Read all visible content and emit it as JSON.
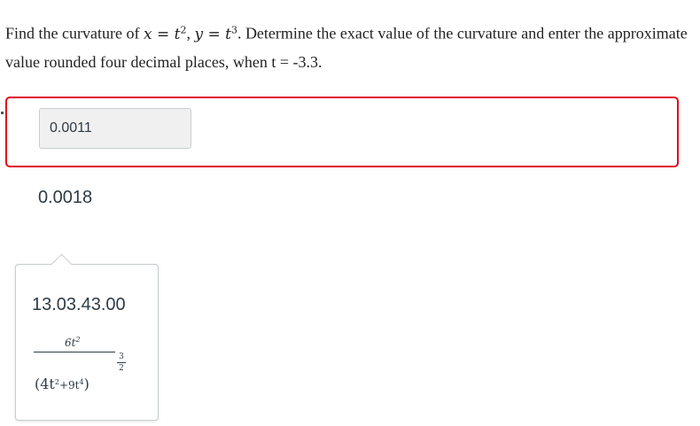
{
  "question": {
    "part1": "Find the curvature of ",
    "math_x": "x = t",
    "math_exp_x": "2",
    "comma": ", ",
    "math_y": "y = t",
    "math_exp_y": "3",
    "part2": ". Determine the exact value of the curvature and enter the approximate value rounded four decimal places, when t = -3.3."
  },
  "answer": {
    "submitted_value": "0.0011",
    "status_color": "#e0061f"
  },
  "alt_answer": "0.0018",
  "popover": {
    "value": "13.03.43.00",
    "formula": {
      "numerator": "6t",
      "numerator_exp": "2",
      "den_open": "(4t",
      "den_exp1": "2",
      "den_mid": "+9t",
      "den_exp2": "4",
      "den_close": ")",
      "outer_exp_num": "3",
      "outer_exp_den": "2"
    }
  }
}
